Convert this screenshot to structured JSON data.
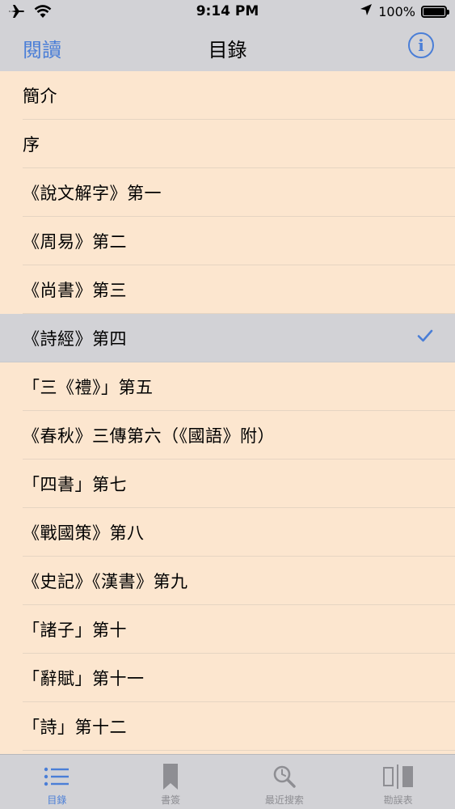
{
  "status": {
    "time": "9:14 PM",
    "battery": "100%",
    "icons": [
      "airplane-icon",
      "wifi-icon",
      "location-arrow-icon",
      "battery-icon"
    ]
  },
  "nav": {
    "back_label": "閱讀",
    "title": "目錄",
    "info_label": "i"
  },
  "list": {
    "items": [
      {
        "label": "簡介"
      },
      {
        "label": "序"
      },
      {
        "label": "《說文解字》第一"
      },
      {
        "label": "《周易》第二"
      },
      {
        "label": "《尚書》第三"
      },
      {
        "label": "《詩經》第四",
        "selected": true
      },
      {
        "label": "「三《禮》」第五"
      },
      {
        "label": "《春秋》三傳第六（《國語》附）"
      },
      {
        "label": "「四書」第七"
      },
      {
        "label": "《戰國策》第八"
      },
      {
        "label": "《史記》《漢書》第九"
      },
      {
        "label": "「諸子」第十"
      },
      {
        "label": "「辭賦」第十一"
      },
      {
        "label": "「詩」第十二"
      }
    ]
  },
  "tabs": [
    {
      "label": "目錄",
      "icon": "list-icon",
      "active": true
    },
    {
      "label": "書簽",
      "icon": "bookmark-icon",
      "active": false
    },
    {
      "label": "最近搜索",
      "icon": "search-icon",
      "active": false
    },
    {
      "label": "勘誤表",
      "icon": "compare-icon",
      "active": false
    }
  ],
  "colors": {
    "accent": "#4a7ed7",
    "list_background": "#fce6cf",
    "chrome_background": "#d2d2d6",
    "inactive": "#8e8e93"
  }
}
